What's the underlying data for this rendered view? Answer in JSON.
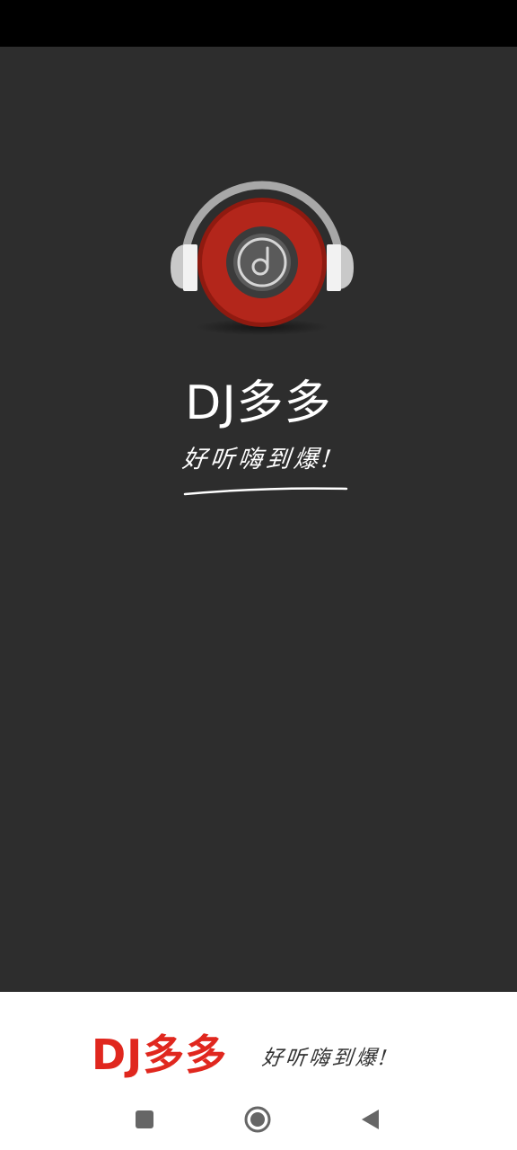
{
  "app": {
    "name": "DJ多多",
    "slogan": "好听嗨到爆!"
  },
  "splash": {
    "background": "#2d2d2d",
    "logo_icon": "headphones-record-icon"
  },
  "bottom_brand": {
    "name": "DJ多多",
    "slogan": "好听嗨到爆!",
    "name_color": "#e0271e"
  },
  "nav_bar": {
    "items": [
      {
        "icon": "recents-square-icon"
      },
      {
        "icon": "home-circle-icon"
      },
      {
        "icon": "back-triangle-icon"
      }
    ]
  }
}
